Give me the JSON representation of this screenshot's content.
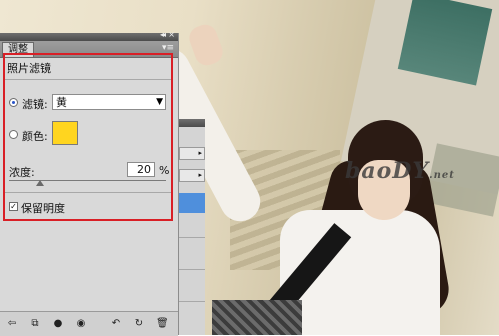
{
  "panel": {
    "collapse_icon": "double-chevron-right-icon",
    "close_icon": "close-icon",
    "tab_label": "调整",
    "menu_icon": "panel-menu-icon"
  },
  "photo_filter": {
    "title": "照片滤镜",
    "filter_label": "滤镜:",
    "filter_value": "黄",
    "filter_selected": true,
    "color_label": "颜色:",
    "color_swatch": "#ffd51f",
    "density_label": "浓度:",
    "density_value": "20",
    "density_unit": "%",
    "density_slider_fraction": 0.2,
    "preserve_luminosity_label": "保留明度",
    "preserve_luminosity_checked": true
  },
  "bottom_toolbar": {
    "icons": [
      "back-arrow-icon",
      "clip-to-layer-icon",
      "visibility-icon",
      "eye-icon",
      "previous-state-icon",
      "reset-icon",
      "trash-icon"
    ]
  },
  "watermark": {
    "text": "baoDY",
    "suffix": ".net"
  },
  "colors": {
    "highlight_border": "#d91f26",
    "selected_row": "#4f8fdc"
  }
}
